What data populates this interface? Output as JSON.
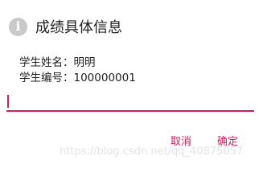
{
  "dialog": {
    "icon": "info-icon",
    "icon_glyph": "i",
    "title": "成绩具体信息",
    "message_lines": [
      "学生姓名：明明",
      "学生编号：100000001"
    ],
    "input": {
      "value": ""
    },
    "buttons": {
      "cancel": "取消",
      "ok": "确定"
    }
  },
  "watermark": "https://blog.csdn.net/qq_40875057",
  "colors": {
    "accent": "#d81b60",
    "icon_bg": "#c9c9c9",
    "text": "#212121"
  }
}
